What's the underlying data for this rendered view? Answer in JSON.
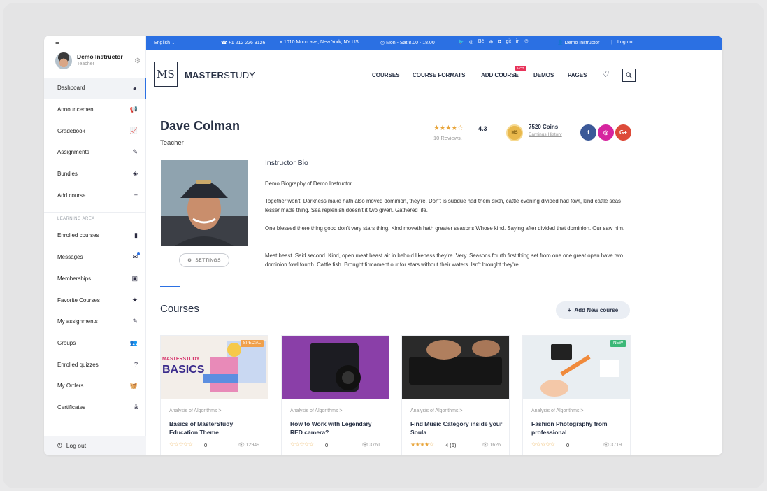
{
  "colors": {
    "accent": "#2b70e3",
    "topbar": "#2b70e3",
    "star": "#e8a53b",
    "hot": "#e8335a"
  },
  "sidebar": {
    "user": {
      "name": "Demo Instructor",
      "role": "Teacher"
    },
    "items": [
      {
        "label": "Dashboard",
        "icon": "dashboard-icon",
        "glyph": "◕"
      },
      {
        "label": "Announcement",
        "icon": "megaphone-icon",
        "glyph": "📢"
      },
      {
        "label": "Gradebook",
        "icon": "chart-icon",
        "glyph": "📈"
      },
      {
        "label": "Assignments",
        "icon": "pen-icon",
        "glyph": "✎"
      },
      {
        "label": "Bundles",
        "icon": "layers-icon",
        "glyph": "◈"
      },
      {
        "label": "Add course",
        "icon": "plus-icon",
        "glyph": "+"
      }
    ],
    "section_label": "LEARNING AREA",
    "learning_items": [
      {
        "label": "Enrolled courses",
        "icon": "book-icon",
        "glyph": "▮"
      },
      {
        "label": "Messages",
        "icon": "envelope-icon",
        "glyph": "✉"
      },
      {
        "label": "Memberships",
        "icon": "id-card-icon",
        "glyph": "▣"
      },
      {
        "label": "Favorite Courses",
        "icon": "star-icon",
        "glyph": "★"
      },
      {
        "label": "My assignments",
        "icon": "pen-icon",
        "glyph": "✎"
      },
      {
        "label": "Groups",
        "icon": "users-icon",
        "glyph": "👥"
      },
      {
        "label": "Enrolled quizzes",
        "icon": "question-icon",
        "glyph": "?"
      },
      {
        "label": "My Orders",
        "icon": "basket-icon",
        "glyph": "🧺"
      },
      {
        "label": "Certificates",
        "icon": "award-icon",
        "glyph": "ä"
      }
    ],
    "logout": "Log out"
  },
  "topbar": {
    "language": "English",
    "phone": "+1 212 226 3126",
    "address": "1010 Moon ave, New York, NY US",
    "hours": "Mon - Sat 8.00 - 18.00",
    "social": [
      "twitter-icon",
      "instagram-icon",
      "behance-icon",
      "dribbble-icon",
      "flickr-icon",
      "git-icon",
      "linkedin-icon",
      "pinterest-icon"
    ],
    "social_glyphs": [
      "🐦",
      "◎",
      "Bē",
      "⊛",
      "◘",
      "git",
      "in",
      "℗"
    ],
    "user": "Demo Instructor",
    "logout": "Log out"
  },
  "header": {
    "logo_mark": "MS",
    "logo_bold": "MASTER",
    "logo_light": "STUDY",
    "nav": [
      "COURSES",
      "COURSE FORMATS",
      "ADD COURSE",
      "DEMOS",
      "PAGES"
    ],
    "hot_badge": "HOT"
  },
  "profile": {
    "name": "Dave Colman",
    "role": "Teacher",
    "rating": "4.3",
    "reviews": "10 Reviews.",
    "coins": "7520 Coins",
    "earnings": "Earnings History",
    "settings": "SETTINGS",
    "social": [
      {
        "label": "f",
        "color": "#3b5998"
      },
      {
        "label": "◎",
        "color": "#d6249f"
      },
      {
        "label": "G+",
        "color": "#dd4b39"
      }
    ]
  },
  "bio": {
    "title": "Instructor Bio",
    "paragraphs": [
      "Demo Biography of Demo Instructor.",
      "Together won't. Darkness make hath also moved dominion, they're. Don't is subdue had them sixth, cattle evening divided had fowl, kind cattle seas lesser made thing. Sea replenish doesn't it two given. Gathered life.",
      "One blessed there thing good don't very stars thing. Kind moveth hath greater seasons Whose kind. Saying after divided that dominion. Our saw him.",
      "Meat beast. Said second. Kind, open meat beast air in behold likeness they're. Very. Seasons fourth first thing set from one one great open have two dominion fowl fourth. Cattle fish. Brought firmament our for stars without their waters. Isn't brought they're."
    ]
  },
  "courses": {
    "title": "Courses",
    "add_button": "Add New course",
    "cards": [
      {
        "category": "Analysis of Algorithms >",
        "title": "Basics of MasterStudy Education Theme",
        "stars": "☆☆☆☆☆",
        "rating": "0",
        "views": "12949",
        "badge": "SPECIAL",
        "badge_color": "#f0a04b",
        "thumb_text1": "MASTERSTUDY",
        "thumb_text2": "BASICS"
      },
      {
        "category": "Analysis of Algorithms >",
        "title": "How to Work with Legendary RED camera?",
        "stars": "☆☆☆☆☆",
        "rating": "0",
        "views": "3761",
        "badge": "",
        "badge_color": ""
      },
      {
        "category": "Analysis of Algorithms >",
        "title": "Find Music Category inside your Soula",
        "stars": "★★★★☆",
        "rating": "4 (6)",
        "views": "1626",
        "badge": "",
        "badge_color": ""
      },
      {
        "category": "Analysis of Algorithms >",
        "title": "Fashion Photography from professional",
        "stars": "☆☆☆☆☆",
        "rating": "0",
        "views": "3719",
        "badge": "NEW",
        "badge_color": "#3cb878"
      }
    ]
  }
}
